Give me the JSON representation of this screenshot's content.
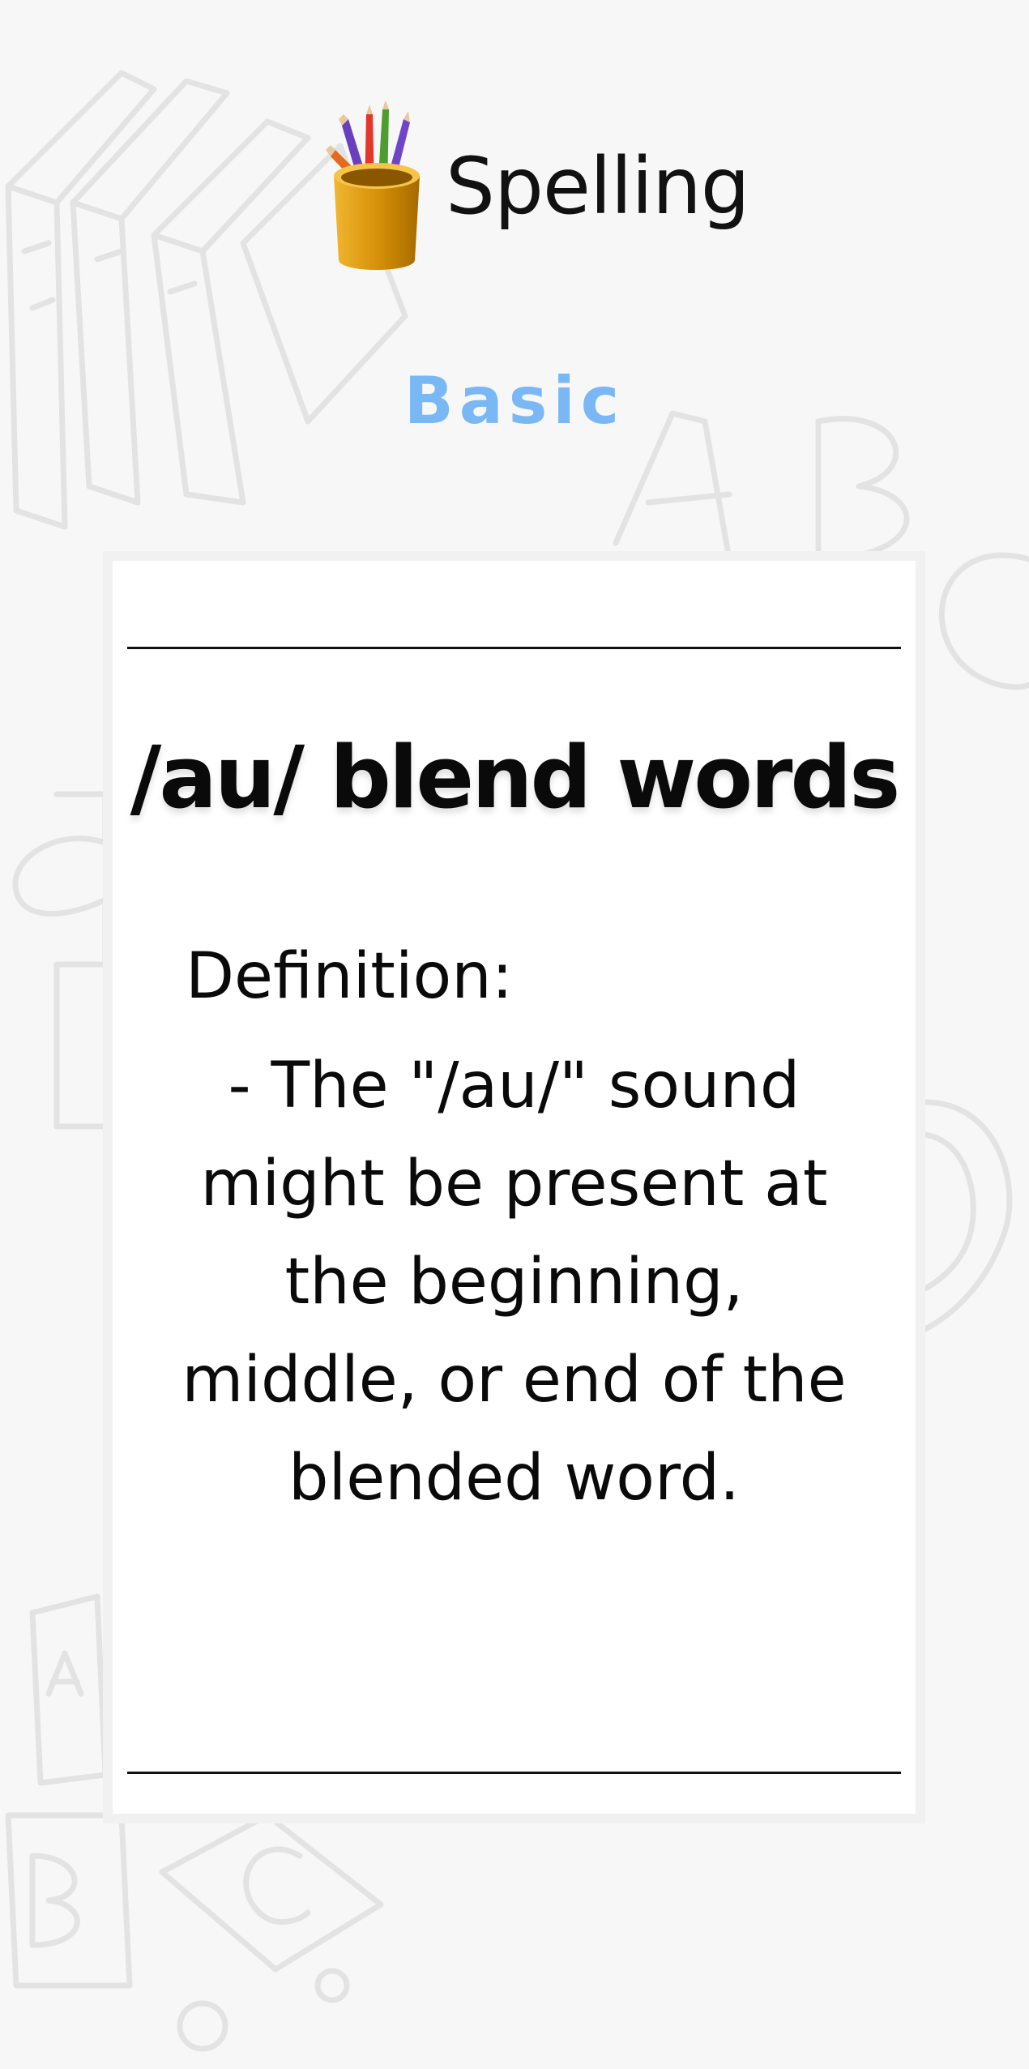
{
  "app": {
    "title": "Spelling",
    "icon": "pencil-cup-icon"
  },
  "level": {
    "label": "Basic",
    "color": "#7ab8f5"
  },
  "card": {
    "title": "/au/ blend words",
    "definition_label": "Definition:",
    "definition_text": "- The \"/au/\" sound might be present at the beginning, middle, or end of the blended word."
  },
  "background": {
    "doodles": [
      "books-doodle",
      "letter-a-doodle",
      "letter-b-doodle",
      "letter-c-doodle",
      "puzzle-doodle",
      "mug-doodle",
      "abc-blocks-doodle"
    ]
  }
}
